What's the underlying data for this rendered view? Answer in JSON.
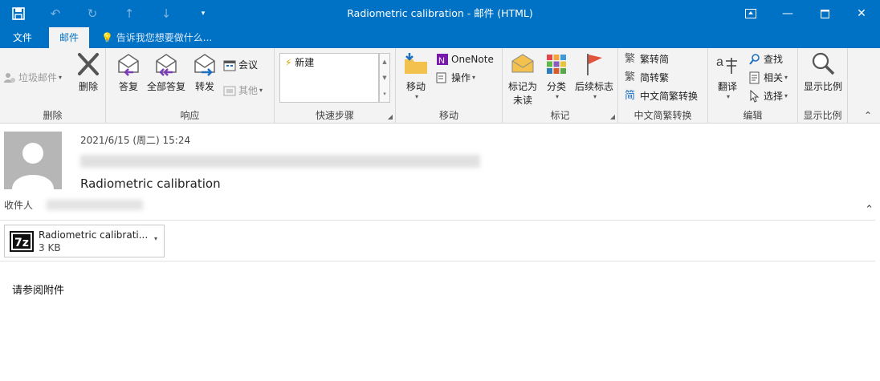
{
  "window": {
    "title": "Radiometric calibration - 邮件 (HTML)"
  },
  "tabs": {
    "file": "文件",
    "mail": "邮件",
    "tell_me": "告诉我您想要做什么..."
  },
  "ribbon": {
    "delete_group": {
      "label": "删除",
      "junk": "垃圾邮件",
      "delete": "删除"
    },
    "respond_group": {
      "label": "响应",
      "reply": "答复",
      "reply_all": "全部答复",
      "forward": "转发",
      "meeting": "会议",
      "more": "其他"
    },
    "quick_steps_group": {
      "label": "快速步骤",
      "item_new": "新建"
    },
    "move_group": {
      "label": "移动",
      "move": "移动",
      "onenote": "OneNote",
      "actions": "操作"
    },
    "tags_group": {
      "label": "标记",
      "mark_unread_1": "标记为",
      "mark_unread_2": "未读",
      "categorize": "分类",
      "follow_up": "后续标志"
    },
    "chinese_group": {
      "label": "中文简繁转换",
      "to_simplified": "繁转简",
      "to_traditional": "简转繁",
      "convert": "中文简繁转换"
    },
    "edit_group": {
      "label": "编辑",
      "translate": "翻译",
      "find": "查找",
      "related": "相关",
      "select": "选择"
    },
    "zoom_group": {
      "label": "显示比例",
      "zoom": "显示比例"
    }
  },
  "message": {
    "date": "2021/6/15 (周二) 15:24",
    "subject": "Radiometric calibration",
    "to_label": "收件人",
    "attachment": {
      "name": "Radiometric calibrati...",
      "size": "3 KB"
    },
    "body": "请参阅附件"
  },
  "colors": {
    "accent": "#0072c6",
    "ribbon_bg": "#f3f3f3"
  }
}
